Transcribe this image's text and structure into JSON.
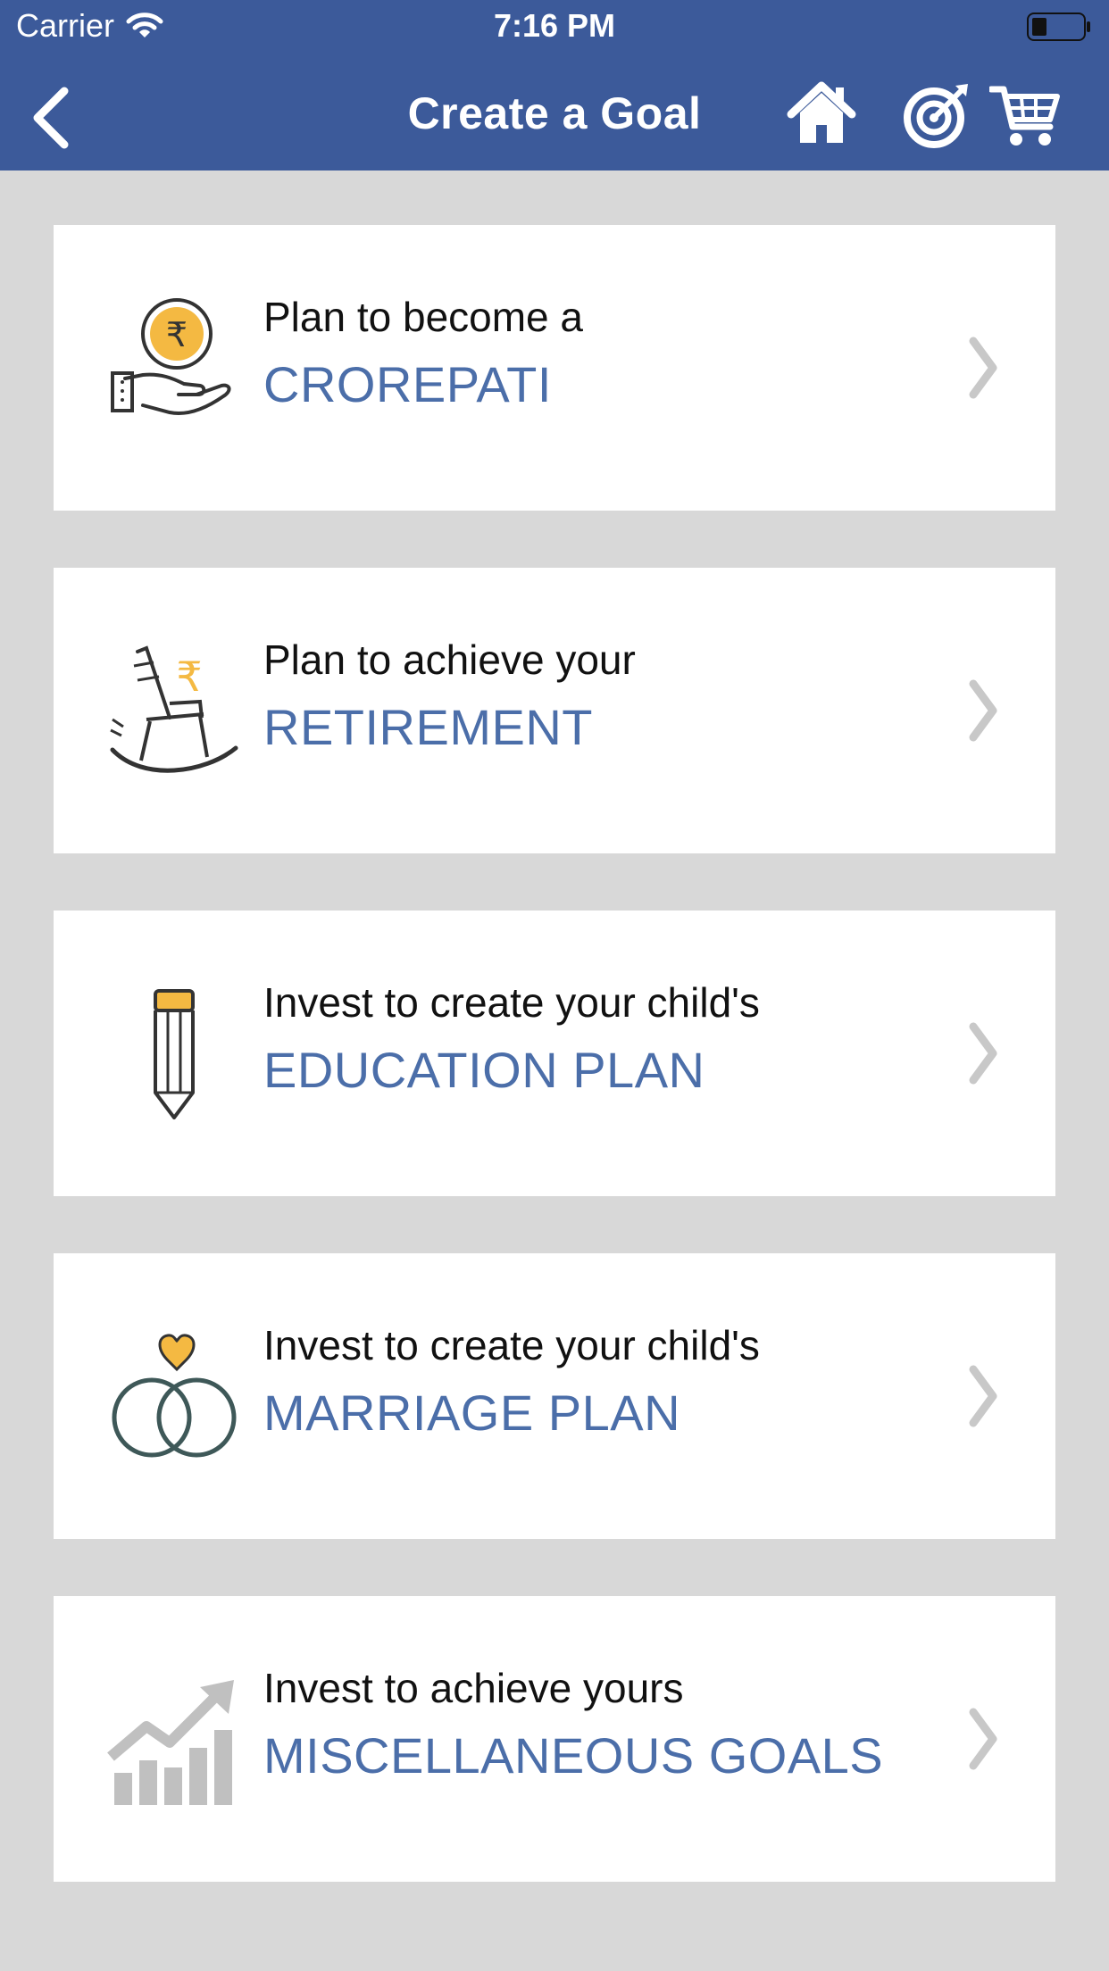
{
  "status_bar": {
    "carrier": "Carrier",
    "time": "7:16 PM"
  },
  "header": {
    "title": "Create a Goal"
  },
  "goals": [
    {
      "line1": "Plan to become a",
      "line2": "CROREPATI"
    },
    {
      "line1": "Plan to achieve your",
      "line2": "RETIREMENT"
    },
    {
      "line1": "Invest to create your child's",
      "line2": "EDUCATION PLAN"
    },
    {
      "line1": "Invest to create your child's",
      "line2": "MARRIAGE PLAN"
    },
    {
      "line1": "Invest to achieve yours",
      "line2": "MISCELLANEOUS GOALS"
    }
  ],
  "colors": {
    "header_bg": "#3c5a9a",
    "accent_text": "#4b6ea9",
    "icon_gold": "#f4b942",
    "page_bg": "#d8d8d8"
  }
}
